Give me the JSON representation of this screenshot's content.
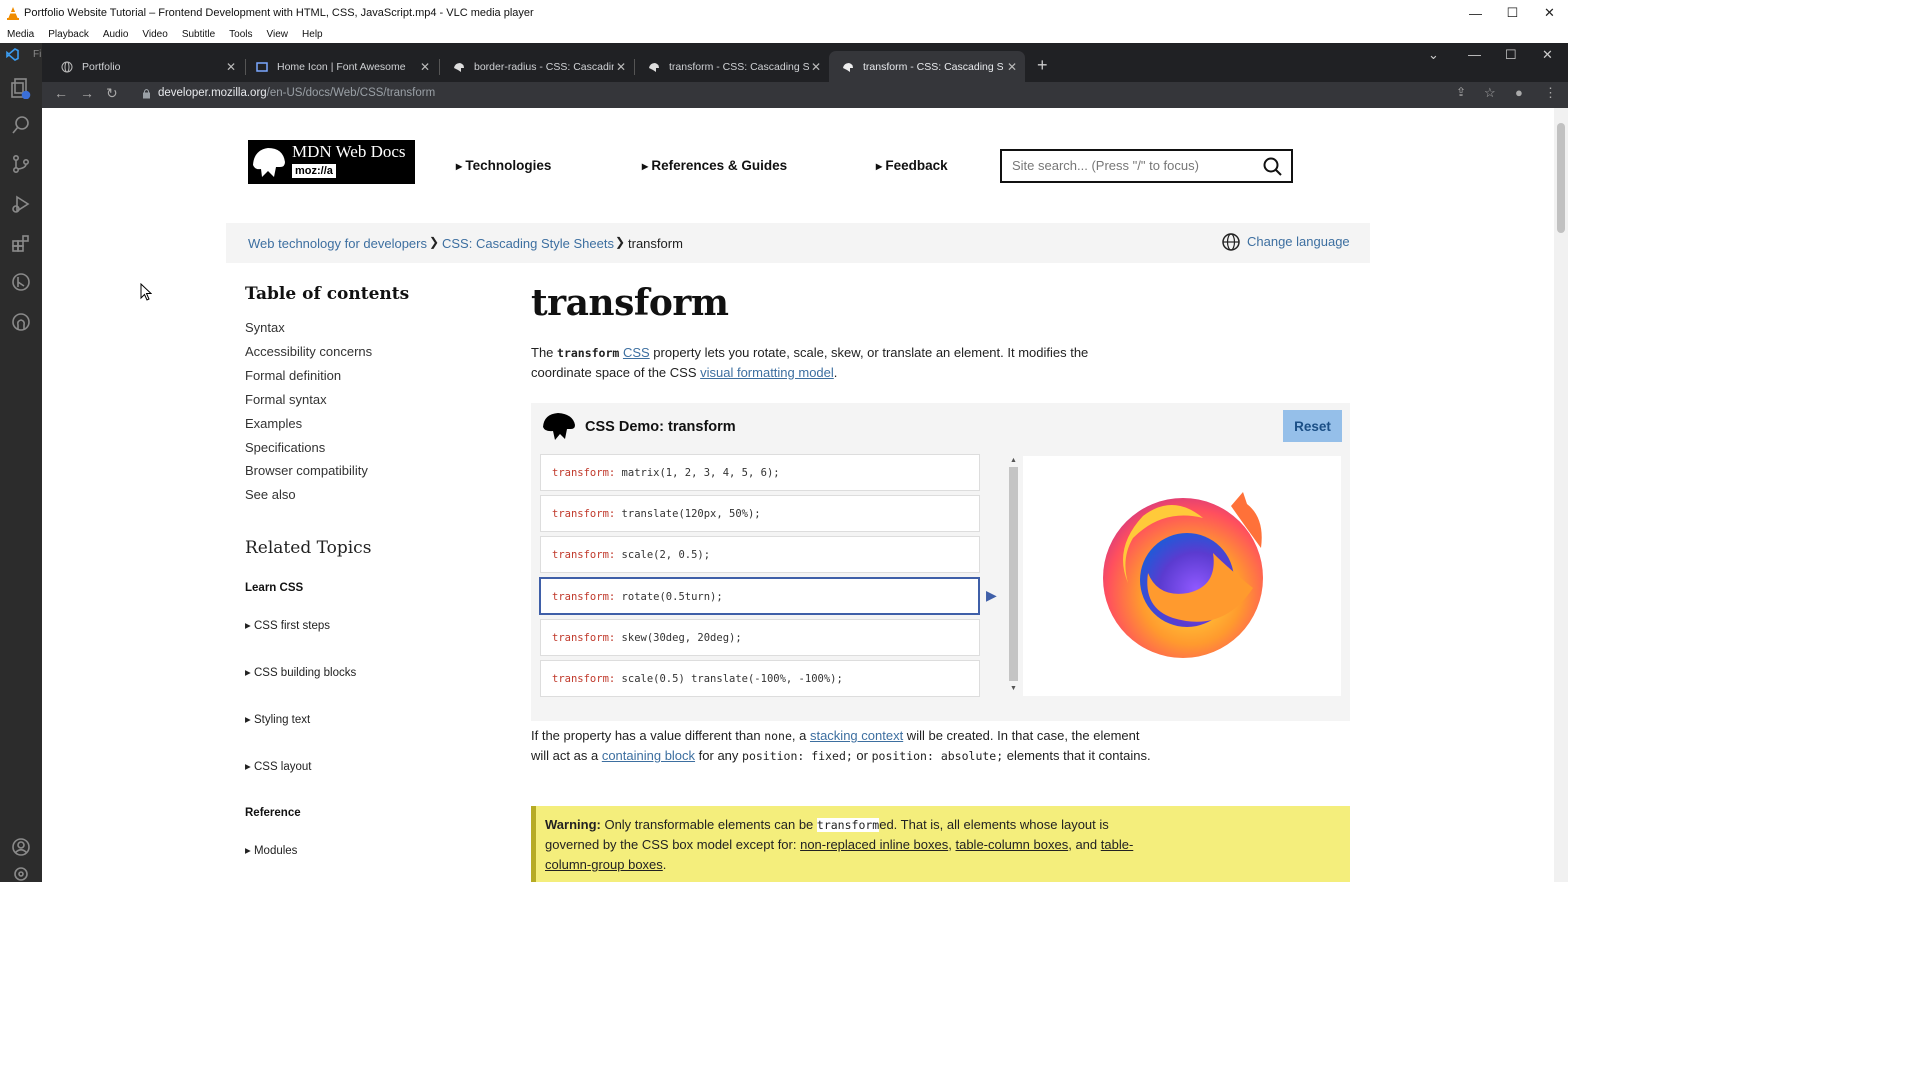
{
  "vlc": {
    "title": "Portfolio Website Tutorial – Frontend Development with HTML, CSS, JavaScript.mp4 - VLC media player",
    "menu": [
      "Media",
      "Playback",
      "Audio",
      "Video",
      "Subtitle",
      "Tools",
      "View",
      "Help"
    ],
    "window_controls": [
      "—",
      "☐",
      "✕"
    ]
  },
  "vscode": {
    "label": "Fi"
  },
  "browser": {
    "tabs": [
      {
        "label": "Portfolio",
        "icon": "globe-icon"
      },
      {
        "label": "Home Icon | Font Awesome",
        "icon": "flag-icon"
      },
      {
        "label": "border-radius - CSS: Cascading S",
        "icon": "mdn-dino-icon"
      },
      {
        "label": "transform - CSS: Cascading Style",
        "icon": "mdn-dino-icon"
      },
      {
        "label": "transform - CSS: Cascading Style",
        "icon": "mdn-dino-icon",
        "active": true
      }
    ],
    "new_tab": "+",
    "url_host": "developer.mozilla.org",
    "url_path": "/en-US/docs/Web/CSS/transform"
  },
  "mdn": {
    "logo_title": "MDN Web Docs",
    "logo_sub": "moz://a",
    "nav": [
      "Technologies",
      "References & Guides",
      "Feedback"
    ],
    "search_placeholder": "Site search... (Press \"/\" to focus)",
    "breadcrumbs": [
      "Web technology for developers",
      "CSS: Cascading Style Sheets",
      "transform"
    ],
    "change_language": "Change language",
    "toc_title": "Table of contents",
    "toc": [
      "Syntax",
      "Accessibility concerns",
      "Formal definition",
      "Formal syntax",
      "Examples",
      "Specifications",
      "Browser compatibility",
      "See also"
    ],
    "related_title": "Related Topics",
    "learn_css": "Learn CSS",
    "learn_items": [
      "CSS first steps",
      "CSS building blocks",
      "Styling text",
      "CSS layout"
    ],
    "reference": "Reference",
    "reference_items": [
      "Modules"
    ],
    "page_title": "transform",
    "intro": {
      "t1": "The ",
      "code": "transform",
      "link1": "CSS",
      "t2": " property lets you rotate, scale, skew, or translate an element. It modifies the coordinate space of the CSS ",
      "link2": "visual formatting model",
      "t3": "."
    },
    "demo": {
      "title": "CSS Demo: transform",
      "reset": "Reset",
      "choices": [
        {
          "prop": "transform:",
          "val": "matrix(1, 2, 3, 4, 5, 6);"
        },
        {
          "prop": "transform:",
          "val": "translate(120px, 50%);"
        },
        {
          "prop": "transform:",
          "val": "scale(2, 0.5);"
        },
        {
          "prop": "transform:",
          "val": "rotate(0.5turn);",
          "selected": true
        },
        {
          "prop": "transform:",
          "val": "skew(30deg, 20deg);"
        },
        {
          "prop": "transform:",
          "val": "scale(0.5) translate(-100%, -100%);",
          "prop2": "transform:",
          "compound": true
        }
      ]
    },
    "p2": {
      "t1": "If the property has a value different than ",
      "code1": "none",
      "t2": ", a ",
      "link1": "stacking context",
      "t3": " will be created. In that case, the element will act as a ",
      "link2": "containing block",
      "t4": " for any ",
      "code2": "position: fixed;",
      "t5": " or ",
      "code3": "position: absolute;",
      "t6": " elements that it contains."
    },
    "warning": {
      "label": "Warning:",
      "t1": " Only transformable elements can be ",
      "code": "transform",
      "t2": "ed. That is, all elements whose layout is governed by the CSS box model except for: ",
      "link1": "non-replaced inline boxes",
      "t3": ", ",
      "link2": "table-column boxes",
      "t4": ", and ",
      "link3": "table-column-group boxes",
      "t5": "."
    }
  },
  "colors": {
    "link": "#3d6fa0",
    "warning_bg": "#f4ee7c",
    "reset_bg": "#95bfe9",
    "selected_border": "#3f5fa8"
  }
}
